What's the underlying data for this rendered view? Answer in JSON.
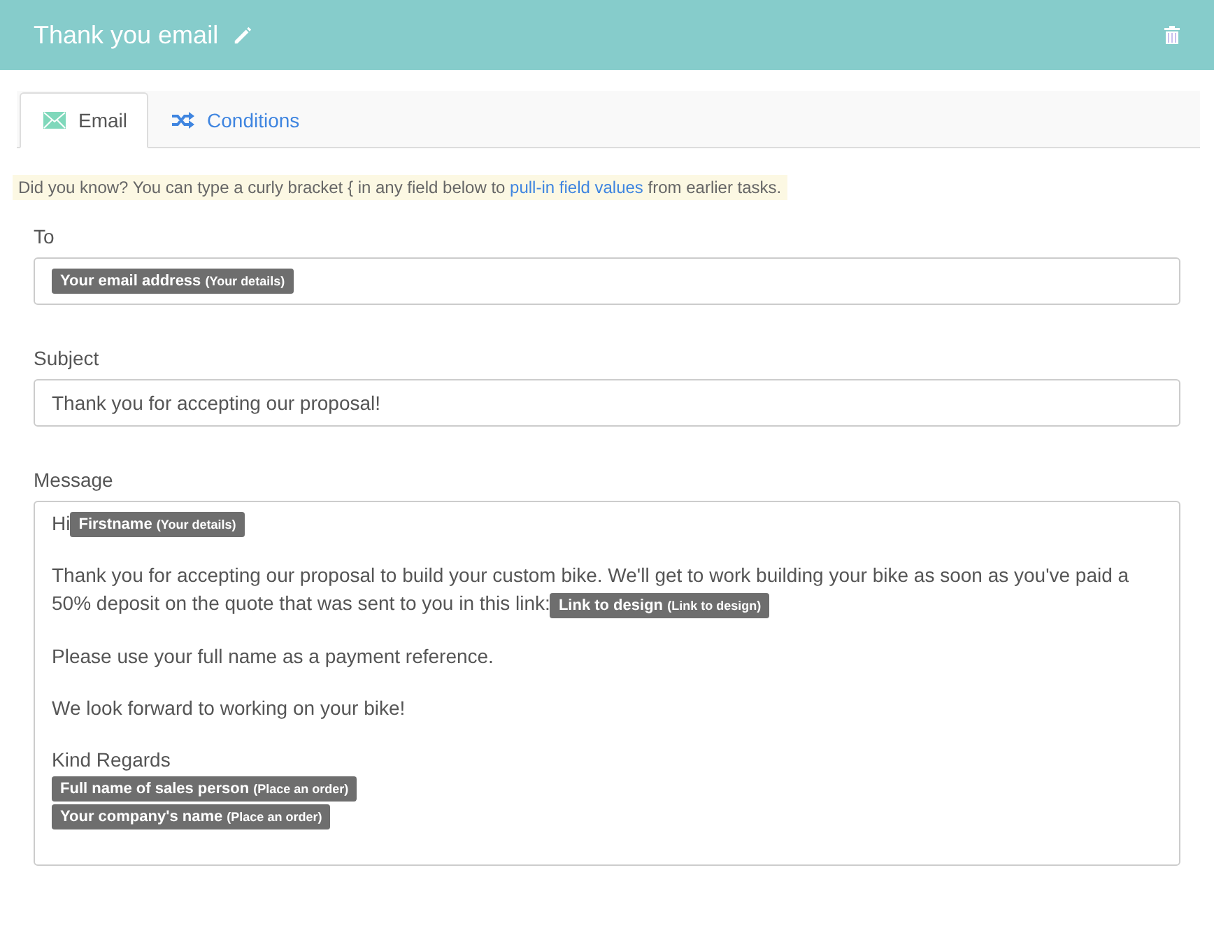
{
  "header": {
    "title": "Thank you email"
  },
  "tabs": [
    {
      "label": "Email",
      "kind": "envelope",
      "selected": true
    },
    {
      "label": "Conditions",
      "kind": "shuffle",
      "selected": false
    }
  ],
  "tip": {
    "before": "Did you know? You can type a curly bracket { in any field below to",
    "link": "pull-in field values",
    "after": "from earlier tasks."
  },
  "fields": [
    {
      "label": "To",
      "kind": "tokens",
      "tokens": [
        {
          "label": "Your email address",
          "source": "(Your details)"
        }
      ]
    },
    {
      "label": "Subject",
      "kind": "text",
      "value": "Thank you for accepting our proposal!"
    }
  ],
  "message": {
    "label": "Message",
    "blocks": [
      {
        "lines": [
          [
            {
              "kind": "text",
              "text": "Hi"
            },
            {
              "kind": "token",
              "label": "Firstname",
              "source": "(Your details)"
            }
          ]
        ]
      },
      {
        "lines": [
          [
            {
              "kind": "text",
              "text": "Thank you for accepting our proposal to build your custom bike. We'll get to work building your bike as soon as you've paid a 50% deposit on the quote that was sent to you in this link:"
            },
            {
              "kind": "token",
              "label": "Link to design",
              "source": "(Link to design)"
            }
          ]
        ]
      },
      {
        "lines": [
          [
            {
              "kind": "text",
              "text": "Please use your full name as a payment reference."
            }
          ]
        ]
      },
      {
        "lines": [
          [
            {
              "kind": "text",
              "text": "We look forward to working on your bike!"
            }
          ]
        ]
      },
      {
        "lines": [
          [
            {
              "kind": "text",
              "text": "Kind Regards"
            }
          ],
          [
            {
              "kind": "token",
              "label": "Full name of sales person",
              "source": "(Place an order)"
            }
          ],
          [
            {
              "kind": "token",
              "label": "Your company's name",
              "source": "(Place an order)"
            }
          ]
        ]
      }
    ]
  }
}
